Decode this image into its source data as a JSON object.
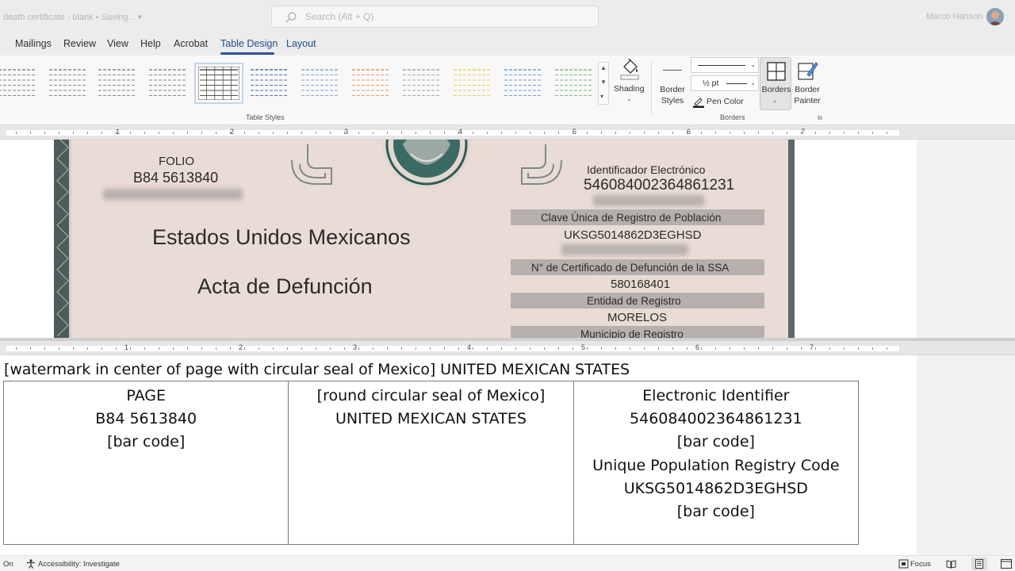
{
  "titlebar": {
    "doc_title": "death certificate - blank • Saving... ▾",
    "search_placeholder": "Search (Alt + Q)",
    "user_name": "Marco Hanson"
  },
  "tabs": [
    {
      "label": "Mailings"
    },
    {
      "label": "Review"
    },
    {
      "label": "View"
    },
    {
      "label": "Help"
    },
    {
      "label": "Acrobat"
    },
    {
      "label": "Table Design",
      "active": true
    },
    {
      "label": "Layout"
    }
  ],
  "ribbon": {
    "table_styles_label": "Table Styles",
    "shading_label": "Shading",
    "border_styles_label": "Border Styles",
    "line_weight": "½ pt",
    "pen_color_label": "Pen Color",
    "borders_label": "Borders",
    "border_painter_label": "Border Painter",
    "borders_group_label": "Borders"
  },
  "ruler_top": [
    "1",
    "2",
    "3",
    "4",
    "5",
    "6",
    "7"
  ],
  "ruler_bottom": [
    "1",
    "2",
    "3",
    "4",
    "5",
    "6",
    "7"
  ],
  "certificate": {
    "folio_label": "FOLIO",
    "folio_value": "B84 5613840",
    "country": "Estados Unidos Mexicanos",
    "doc_type": "Acta de Defunción",
    "id_label": "Identificador Electrónico",
    "id_value": "546084002364861231",
    "curp_label": "Clave Única de Registro de Población",
    "curp_value": "UKSG5014862D3EGHSD",
    "ssa_label": "N° de Certificado de Defunción de la SSA",
    "ssa_value": "580168401",
    "entity_label": "Entidad de Registro",
    "entity_value": "MORELOS",
    "municipality_label": "Municipio de Registro"
  },
  "translation": {
    "watermark_line": "[watermark in center of page with circular seal of Mexico] UNITED MEXICAN STATES",
    "col1": [
      "PAGE",
      "B84 5613840",
      "[bar code]"
    ],
    "col2": [
      "[round circular seal of Mexico]",
      "UNITED MEXICAN STATES"
    ],
    "col3": [
      "Electronic Identifier",
      "546084002364861231",
      "[bar code]",
      "Unique Population Registry Code",
      "UKSG5014862D3EGHSD",
      "[bar code]"
    ]
  },
  "statusbar": {
    "left": "On",
    "accessibility": "Accessibility: Investigate",
    "focus": "Focus"
  },
  "colors": {
    "accent": "#2b579a",
    "active_tab_text": "#1e4e8c",
    "certificate_paper": "#e9dcd4"
  }
}
